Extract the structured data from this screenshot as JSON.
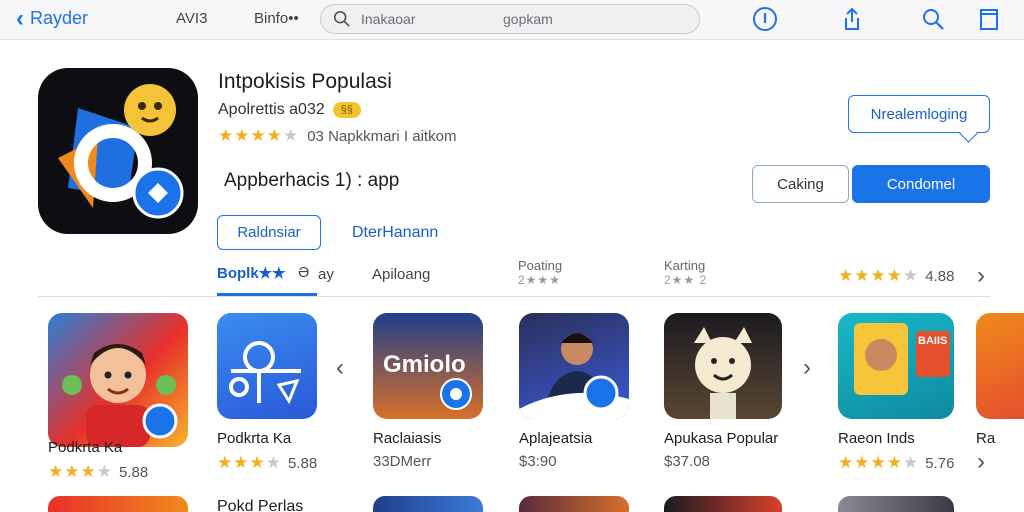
{
  "topbar": {
    "back_label": "Rayder",
    "nav_a": "AVI3",
    "nav_b": "Binfo••",
    "search_placeholder": "Inakaoar",
    "search_placeholder_2": "gopkam"
  },
  "app": {
    "title": "Intpokisis Populasi",
    "subtitle": "Apolrettis a032",
    "badge": "§§",
    "rating_text": "03  Napkkmari I aitkom",
    "description": "Appberhacis 1) : app"
  },
  "buttons": {
    "bubble_label": "Nrealemloging",
    "secondary_label": "Caking",
    "primary_label": "Condomel",
    "outline_label": "Raldnsiar",
    "link_label": "DterHanann"
  },
  "tabs": [
    {
      "label": "Boplk★★",
      "extra": "Ə"
    },
    {
      "label": "ay"
    },
    {
      "label": "Apiloang"
    }
  ],
  "stats": [
    {
      "label": "Poating",
      "value": "2★★★"
    },
    {
      "label": "Karting",
      "value": "2★★ 2"
    }
  ],
  "overall_rating": "4.88",
  "cards": [
    {
      "name": "Podkrta Ka",
      "meta": "5.88",
      "stars": 3
    },
    {
      "name": "Raclaiasis",
      "meta": "33DMerr",
      "stars": 0
    },
    {
      "name": "Aplajeatsia",
      "meta": "$3:90",
      "stars": 0
    },
    {
      "name": "Apukasa Popular",
      "meta": "$37.08",
      "stars": 0
    },
    {
      "name": "Raeon Inds",
      "meta": "5.76",
      "stars": 4
    },
    {
      "name": "Ra",
      "meta": "",
      "stars": 0
    }
  ],
  "thumb_texts": {
    "card2": "Gmiolo",
    "card5": "BAIIS"
  },
  "row2_title": "Pokd Perlas",
  "colors": {
    "accent": "#1a73e8",
    "star": "#f2b01e"
  }
}
